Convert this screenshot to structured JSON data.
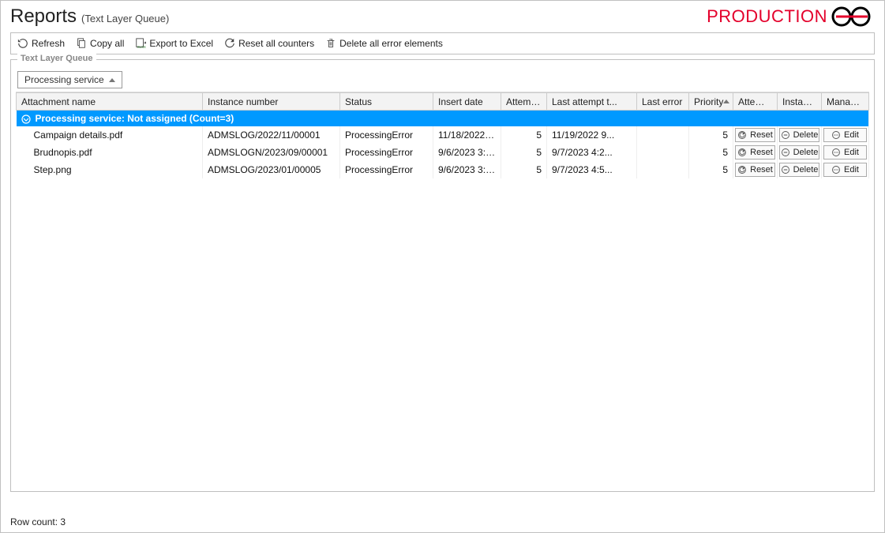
{
  "header": {
    "title": "Reports",
    "subtitle": "(Text Layer Queue)",
    "brand": "PRODUCTION"
  },
  "toolbar": {
    "refresh": "Refresh",
    "copy_all": "Copy all",
    "export_excel": "Export to Excel",
    "reset_counters": "Reset all counters",
    "delete_errors": "Delete all error elements"
  },
  "fieldset_legend": "Text Layer Queue",
  "group_by_label": "Processing service",
  "columns": {
    "attachment": "Attachment name",
    "instance_number": "Instance number",
    "status": "Status",
    "insert_date": "Insert date",
    "attempts": "Attemp...",
    "last_attempt": "Last attempt t...",
    "last_error": "Last error",
    "priority": "Priority",
    "attempts_limit": "Attemp...",
    "instance": "Instance",
    "manage": "Manage p..."
  },
  "group_row": "Processing service: Not assigned (Count=3)",
  "action_labels": {
    "reset": "Reset",
    "delete": "Delete",
    "edit": "Edit"
  },
  "rows": [
    {
      "attachment": "Campaign details.pdf",
      "instance_number": "ADMSLOG/2022/11/00001",
      "status": "ProcessingError",
      "insert_date": "11/18/2022 8...",
      "attempts": "5",
      "last_attempt": "11/19/2022 9...",
      "last_error": "",
      "priority": "5"
    },
    {
      "attachment": "Brudnopis.pdf",
      "instance_number": "ADMSLOGN/2023/09/00001",
      "status": "ProcessingError",
      "insert_date": "9/6/2023 3:1...",
      "attempts": "5",
      "last_attempt": "9/7/2023 4:2...",
      "last_error": "",
      "priority": "5"
    },
    {
      "attachment": "Step.png",
      "instance_number": "ADMSLOG/2023/01/00005",
      "status": "ProcessingError",
      "insert_date": "9/6/2023 3:4...",
      "attempts": "5",
      "last_attempt": "9/7/2023 4:5...",
      "last_error": "",
      "priority": "5"
    }
  ],
  "footer": {
    "row_count": "Row count: 3"
  }
}
